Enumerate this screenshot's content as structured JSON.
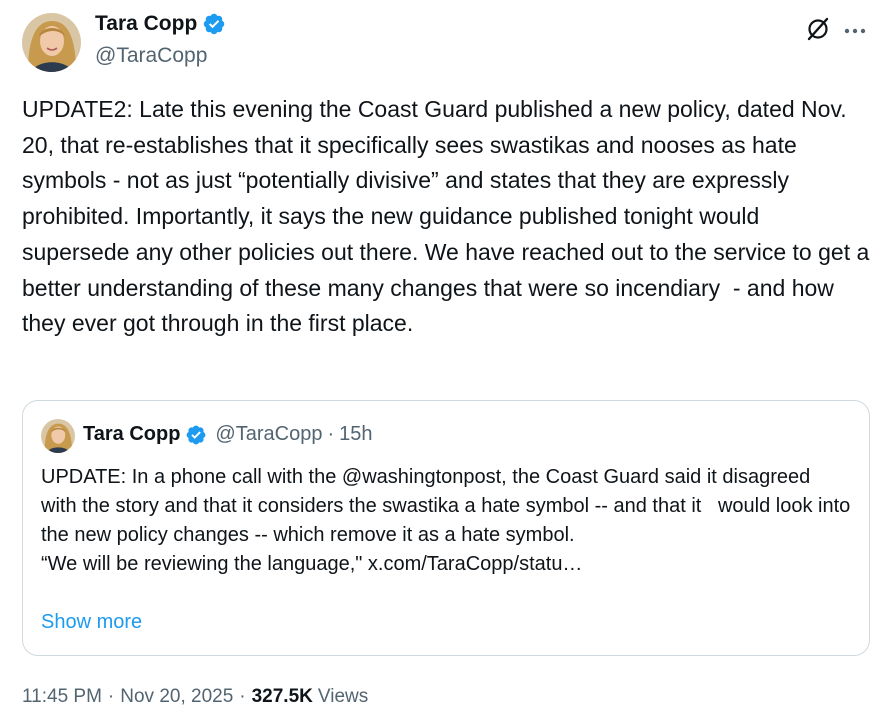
{
  "author": {
    "name": "Tara Copp",
    "handle": "@TaraCopp"
  },
  "tweet": {
    "text": "UPDATE2: Late this evening the Coast Guard published a new policy, dated Nov. 20, that re-establishes that it specifically sees swastikas and nooses as hate symbols - not as just “potentially divisive” and states that they are expressly prohibited. Importantly, it says the new guidance published tonight would supersede any other policies out there. We have reached out to the service to get a better understanding of these many changes that were so incendiary  - and how they ever got through in the first place."
  },
  "quote": {
    "name": "Tara Copp",
    "handle": "@TaraCopp",
    "separator": "·",
    "time": "15h",
    "text": "UPDATE: In a phone call with the @washingtonpost, the Coast Guard said it disagreed with the story and that it considers the swastika a hate symbol -- and that it   would look into the new policy changes -- which remove it as a hate symbol.\n“We will be reviewing the language,\" x.com/TaraCopp/statu…",
    "show_more": "Show more"
  },
  "footer": {
    "time": "11:45 PM",
    "sep1": "·",
    "date": "Nov 20, 2025",
    "sep2": "·",
    "views_count": "327.5K",
    "views_label": "Views"
  },
  "icons": {
    "verified": "verified-badge-icon",
    "grok": "grok-icon",
    "more": "more-dots-icon"
  },
  "colors": {
    "accent": "#1d9bf0",
    "text": "#0f1419",
    "secondary": "#536471",
    "border": "#cfd9de"
  }
}
